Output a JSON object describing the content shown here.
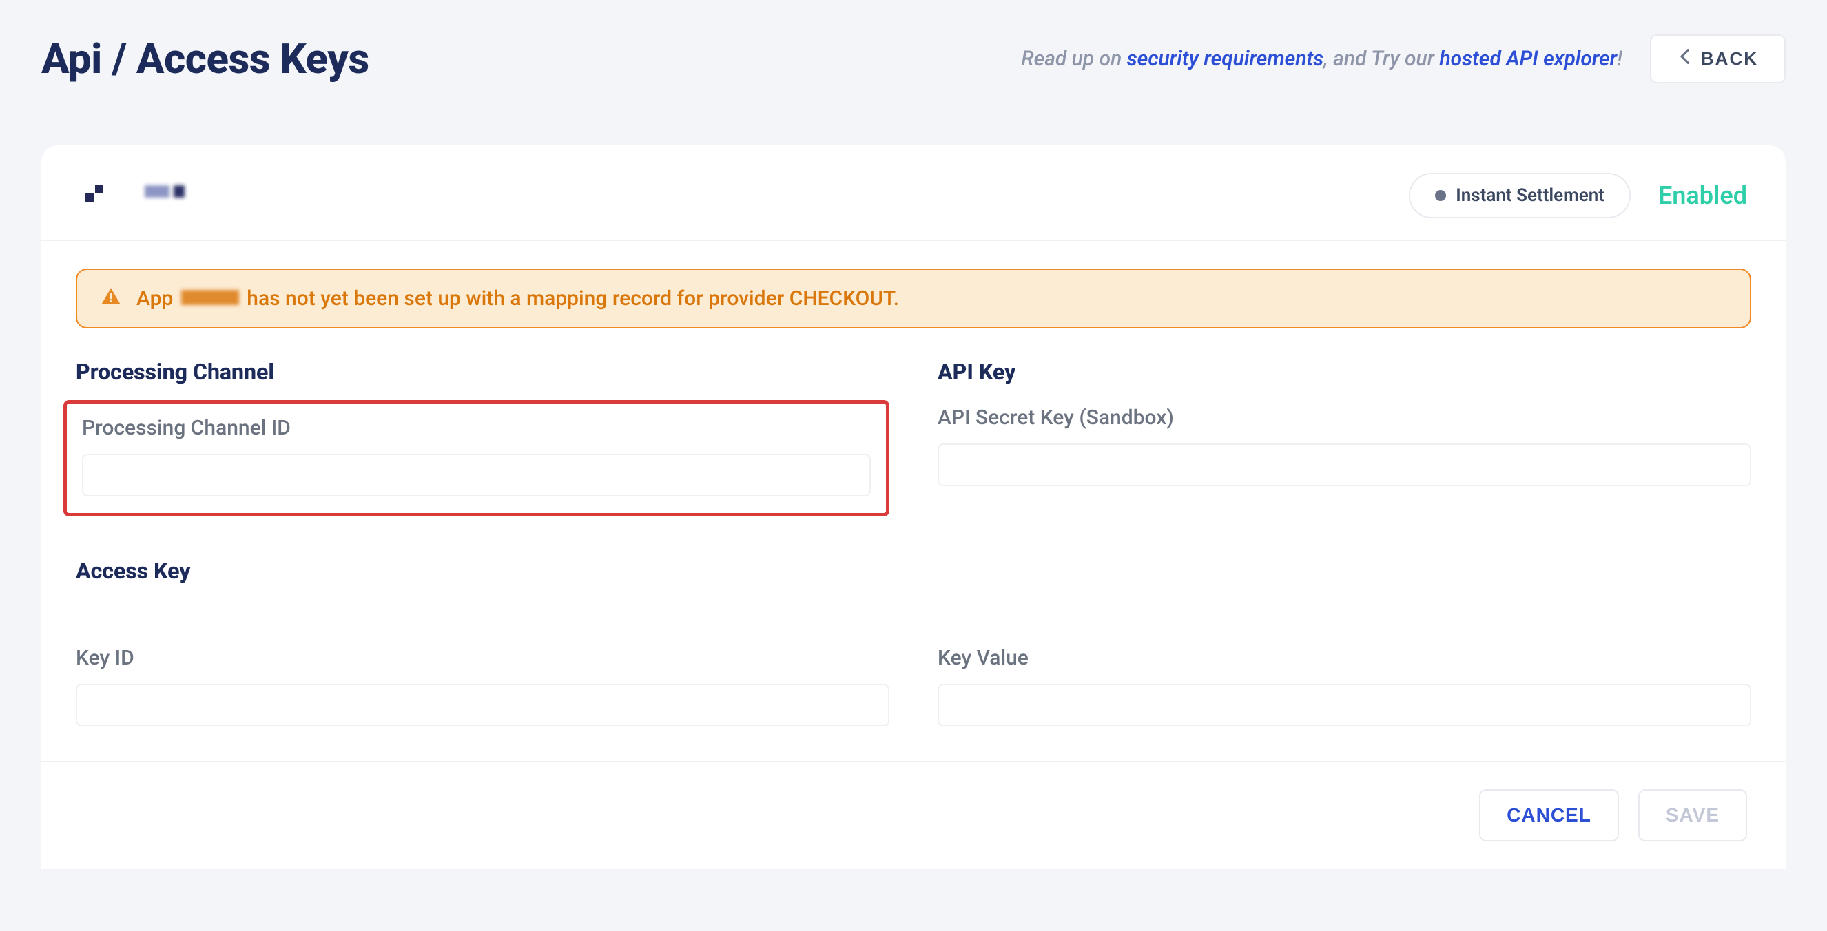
{
  "header": {
    "title": "Api / Access Keys",
    "hint_prefix": "Read up on ",
    "hint_link1": "security requirements",
    "hint_mid": ", and Try our ",
    "hint_link2": "hosted API explorer",
    "hint_suffix": "!",
    "back_label": "BACK"
  },
  "banner": {
    "settlement_label": "Instant Settlement",
    "enabled_text": "Enabled"
  },
  "alert": {
    "prefix": "App",
    "message": " has not yet been set up with a mapping record for provider CHECKOUT."
  },
  "sections": {
    "processing_title": "Processing Channel",
    "processing_label": "Processing Channel ID",
    "apikey_title": "API Key",
    "apikey_label": "API Secret Key (Sandbox)",
    "access_title": "Access Key",
    "key_id_label": "Key ID",
    "key_value_label": "Key Value"
  },
  "footer": {
    "cancel": "CANCEL",
    "save": "SAVE"
  }
}
